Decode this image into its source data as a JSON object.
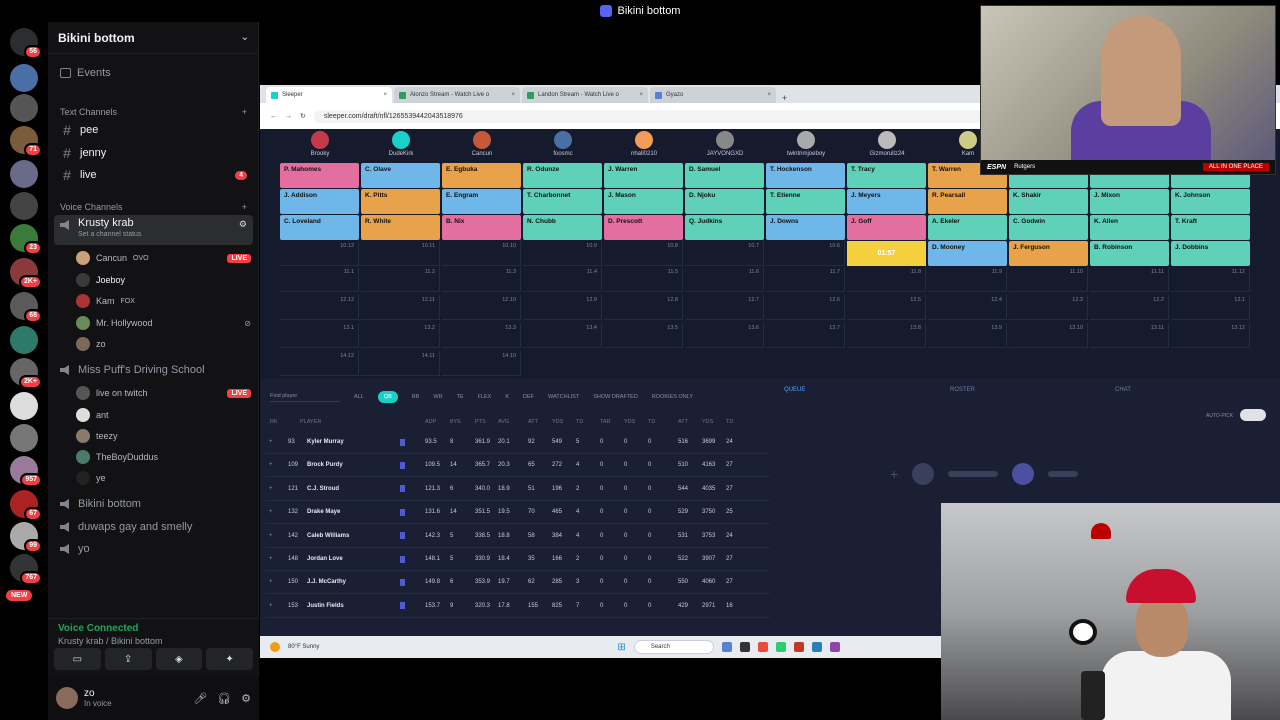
{
  "window_title": "Bikini bottom",
  "colors": {
    "accent": "#5865f2",
    "live": "#f23f43",
    "voice_green": "#23a55a",
    "sleeper_teal": "#19d1c8",
    "timer": "#f4d03f"
  },
  "rail": {
    "badges": [
      "56",
      "71",
      "23",
      "2K+",
      "68",
      "2K+",
      "957",
      "67",
      "99",
      "767"
    ],
    "new_label": "NEW"
  },
  "server": {
    "name": "Bikini bottom",
    "events_label": "Events",
    "text_category": "Text Channels",
    "text_channels": [
      {
        "name": "pee",
        "badge": ""
      },
      {
        "name": "jenny",
        "badge": ""
      },
      {
        "name": "live",
        "badge": "4"
      }
    ],
    "voice_category": "Voice Channels",
    "voice_channels": [
      {
        "name": "Krusty krab",
        "status": "Set a channel status"
      },
      {
        "name": "Miss Puff's Driving School"
      },
      {
        "name": "Bikini bottom"
      },
      {
        "name": "duwaps gay and smelly"
      },
      {
        "name": "yo"
      }
    ],
    "krusty_users": [
      {
        "name": "Cancun",
        "tag": "OVO",
        "live": "LIVE"
      },
      {
        "name": "Joeboy",
        "tag": "",
        "live": ""
      },
      {
        "name": "Kam",
        "tag": "FOX",
        "live": ""
      },
      {
        "name": "Mr. Hollywood",
        "tag": "",
        "live": ""
      },
      {
        "name": "zo",
        "tag": "",
        "live": ""
      }
    ],
    "puff_users": [
      {
        "name": "live on twitch",
        "live": "LIVE"
      },
      {
        "name": "ant",
        "live": ""
      },
      {
        "name": "teezy",
        "live": ""
      },
      {
        "name": "TheBoyDuddus",
        "live": ""
      },
      {
        "name": "ye",
        "live": ""
      }
    ]
  },
  "voice_panel": {
    "status": "Voice Connected",
    "location": "Krusty krab / Bikini bottom"
  },
  "user_panel": {
    "name": "zo",
    "status": "In voice"
  },
  "browser": {
    "tabs": [
      "Sleeper",
      "Alonzo Stream - Watch Live o",
      "Landon Stream - Watch Live o",
      "Gyazo"
    ],
    "url": "sleeper.com/draft/nfl/1265539442043518976"
  },
  "draft": {
    "teams": [
      "Brooky",
      "DudeKirk",
      "Cancun",
      "foosmc",
      "nhall0210",
      "JAYVONGXD",
      "twintrimjoeboy",
      "Gizmorullz24",
      "Kam"
    ],
    "picks": [
      [
        "P. Mahomes",
        "C. Olave",
        "E. Egbuka",
        "R. Odunze",
        "J. Warren",
        "D. Samuel",
        "T. Hockenson",
        "T. Tracy",
        "T. Warren",
        "M. Golden",
        "S. Diggs",
        "C. Kupp"
      ],
      [
        "J. Addison",
        "K. Pitts",
        "E. Engram",
        "T. Charbonnet",
        "J. Mason",
        "D. Njoku",
        "T. Etienne",
        "J. Meyers",
        "R. Pearsall",
        "K. Shakir",
        "J. Mixon",
        "K. Johnson"
      ],
      [
        "C. Loveland",
        "R. White",
        "B. Nix",
        "N. Chubb",
        "D. Prescott",
        "Q. Judkins",
        "J. Downs",
        "J. Goff",
        "A. Ekeler",
        "C. Godwin",
        "K. Allen",
        "T. Kraft"
      ],
      [
        "10.12",
        "10.11",
        "10.10",
        "10.9",
        "10.8",
        "10.7",
        "10.6",
        "",
        "",
        "D. Mooney",
        "J. Ferguson",
        "B. Robinson",
        "J. Dobbins"
      ]
    ],
    "row4_pick_labels": [
      "10.12",
      "10.11",
      "10.10",
      "10.9",
      "10.8",
      "10.7",
      "10.6"
    ],
    "row4_players": [
      "D. Mooney",
      "J. Ferguson",
      "B. Robinson",
      "J. Dobbins"
    ],
    "timer": "01:57",
    "empty_rows": [
      [
        "11.1",
        "11.2",
        "11.3",
        "11.4",
        "11.5",
        "11.6",
        "11.7",
        "11.8",
        "11.9",
        "11.10",
        "11.11",
        "11.12"
      ],
      [
        "12.12",
        "12.11",
        "12.10",
        "12.9",
        "12.8",
        "12.7",
        "12.6",
        "12.5",
        "12.4",
        "12.3",
        "12.2",
        "12.1"
      ],
      [
        "13.1",
        "13.2",
        "13.3",
        "13.4",
        "13.5",
        "13.6",
        "13.7",
        "13.8",
        "13.9",
        "13.10",
        "13.11",
        "13.12"
      ],
      [
        "14.12",
        "14.11",
        "14.10",
        "",
        "",
        "",
        "",
        "",
        "",
        "",
        "",
        ""
      ]
    ]
  },
  "filters": {
    "search_placeholder": "Find player",
    "labels": [
      "ALL",
      "QB",
      "RB",
      "WR",
      "TE",
      "FLEX",
      "K",
      "DEF"
    ],
    "watchlist": "WATCHLIST",
    "show_drafted": "SHOW DRAFTED",
    "rookies_only": "ROOKIES ONLY"
  },
  "panels": {
    "queue": "QUEUE",
    "roster": "ROSTER",
    "chat": "CHAT",
    "autopick": "AUTO-PICK"
  },
  "table": {
    "headers": [
      "RK",
      "PLAYER",
      "ADP",
      "BYE",
      "PTS",
      "AVG",
      "ATT",
      "YDS",
      "TD",
      "TAR",
      "YDS",
      "TD",
      "ATT",
      "YDS",
      "TD"
    ],
    "rows": [
      {
        "rk": "93",
        "name": "Kyler Murray",
        "adp": "93.5",
        "bye": "8",
        "pts": "361.9",
        "avg": "20.1",
        "ratt": "92",
        "ryds": "549",
        "rtd": "5",
        "tar": "0",
        "cyds": "0",
        "ctd": "0",
        "patt": "516",
        "pyds": "3699",
        "ptd": "24"
      },
      {
        "rk": "109",
        "name": "Brock Purdy",
        "adp": "109.5",
        "bye": "14",
        "pts": "365.7",
        "avg": "20.3",
        "ratt": "65",
        "ryds": "272",
        "rtd": "4",
        "tar": "0",
        "cyds": "0",
        "ctd": "0",
        "patt": "510",
        "pyds": "4163",
        "ptd": "27"
      },
      {
        "rk": "121",
        "name": "C.J. Stroud",
        "adp": "121.3",
        "bye": "6",
        "pts": "340.0",
        "avg": "18.9",
        "ratt": "51",
        "ryds": "196",
        "rtd": "2",
        "tar": "0",
        "cyds": "0",
        "ctd": "0",
        "patt": "544",
        "pyds": "4035",
        "ptd": "27"
      },
      {
        "rk": "132",
        "name": "Drake Maye",
        "adp": "131.6",
        "bye": "14",
        "pts": "351.5",
        "avg": "19.5",
        "ratt": "70",
        "ryds": "465",
        "rtd": "4",
        "tar": "0",
        "cyds": "0",
        "ctd": "0",
        "patt": "529",
        "pyds": "3750",
        "ptd": "25"
      },
      {
        "rk": "142",
        "name": "Caleb Williams",
        "adp": "142.3",
        "bye": "5",
        "pts": "338.5",
        "avg": "18.8",
        "ratt": "58",
        "ryds": "384",
        "rtd": "4",
        "tar": "0",
        "cyds": "0",
        "ctd": "0",
        "patt": "531",
        "pyds": "3753",
        "ptd": "24"
      },
      {
        "rk": "148",
        "name": "Jordan Love",
        "adp": "148.1",
        "bye": "5",
        "pts": "330.9",
        "avg": "18.4",
        "ratt": "35",
        "ryds": "166",
        "rtd": "2",
        "tar": "0",
        "cyds": "0",
        "ctd": "0",
        "patt": "522",
        "pyds": "3907",
        "ptd": "27"
      },
      {
        "rk": "150",
        "name": "J.J. McCarthy",
        "adp": "149.8",
        "bye": "6",
        "pts": "353.9",
        "avg": "19.7",
        "ratt": "62",
        "ryds": "285",
        "rtd": "3",
        "tar": "0",
        "cyds": "0",
        "ctd": "0",
        "patt": "550",
        "pyds": "4060",
        "ptd": "27"
      },
      {
        "rk": "153",
        "name": "Justin Fields",
        "adp": "153.7",
        "bye": "9",
        "pts": "320.3",
        "avg": "17.8",
        "ratt": "155",
        "ryds": "825",
        "rtd": "7",
        "tar": "0",
        "cyds": "0",
        "ctd": "0",
        "patt": "429",
        "pyds": "2971",
        "ptd": "16"
      }
    ]
  },
  "taskbar": {
    "search": "Search",
    "weather": "80°F Sunny"
  },
  "cam1": {
    "network": "ESPN",
    "ticker": "Rutgers",
    "promo": "ALL IN ONE PLACE"
  }
}
